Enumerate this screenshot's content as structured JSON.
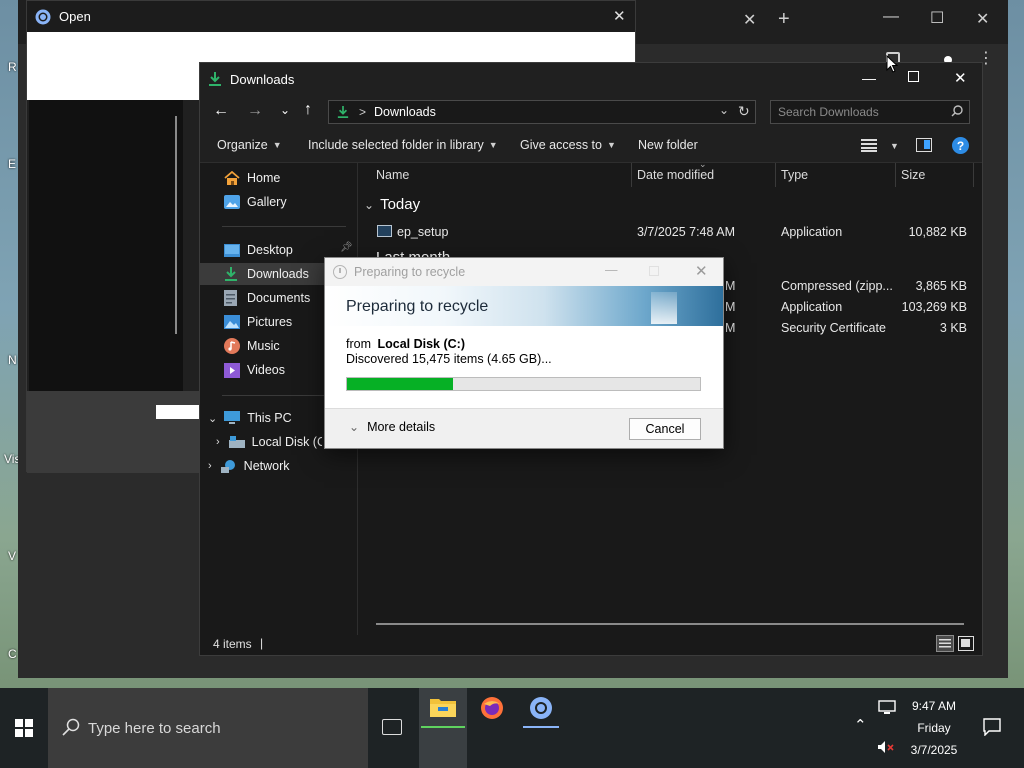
{
  "desktop": {
    "fragments": [
      "R",
      "E",
      "N",
      "Vis",
      "V",
      "C"
    ]
  },
  "open_dialog": {
    "title": "Open"
  },
  "explorer": {
    "title": "Downloads",
    "address": {
      "crumb": "Downloads",
      "separator": ">"
    },
    "search": {
      "placeholder": "Search Downloads"
    },
    "commands": {
      "organize": "Organize",
      "include": "Include selected folder in library",
      "give_access": "Give access to",
      "new_folder": "New folder"
    },
    "nav": {
      "home": "Home",
      "gallery": "Gallery",
      "desktop": "Desktop",
      "downloads": "Downloads",
      "documents": "Documents",
      "pictures": "Pictures",
      "music": "Music",
      "videos": "Videos",
      "this_pc": "This PC",
      "local_disk": "Local Disk (C:",
      "network": "Network"
    },
    "columns": {
      "name": "Name",
      "date": "Date modified",
      "type": "Type",
      "size": "Size"
    },
    "groups": {
      "today": "Today",
      "last_month": "Last month"
    },
    "files": [
      {
        "name": "ep_setup",
        "date": "3/7/2025 7:48 AM",
        "type": "Application",
        "size": "10,882 KB"
      },
      {
        "name": "",
        "date": "M",
        "type": "Compressed (zipp...",
        "size": "3,865 KB"
      },
      {
        "name": "",
        "date": "M",
        "type": "Application",
        "size": "103,269 KB"
      },
      {
        "name": "",
        "date": "M",
        "type": "Security Certificate",
        "size": "3 KB"
      }
    ],
    "status": {
      "items": "4 items",
      "cursor": "|"
    }
  },
  "recycle_dialog": {
    "title": "Preparing to recycle",
    "heading": "Preparing to recycle",
    "from_label": "from",
    "from_value": "Local Disk (C:)",
    "discovered": "Discovered 15,475 items (4.65 GB)...",
    "progress_fraction": 0.3,
    "more_details": "More details",
    "cancel": "Cancel"
  },
  "taskbar": {
    "search_placeholder": "Type here to search",
    "time": "9:47 AM",
    "day": "Friday",
    "date": "3/7/2025"
  },
  "colors": {
    "progress": "#06b025",
    "downloads_green": "#2fb36a",
    "help_blue": "#2d8ce6"
  }
}
